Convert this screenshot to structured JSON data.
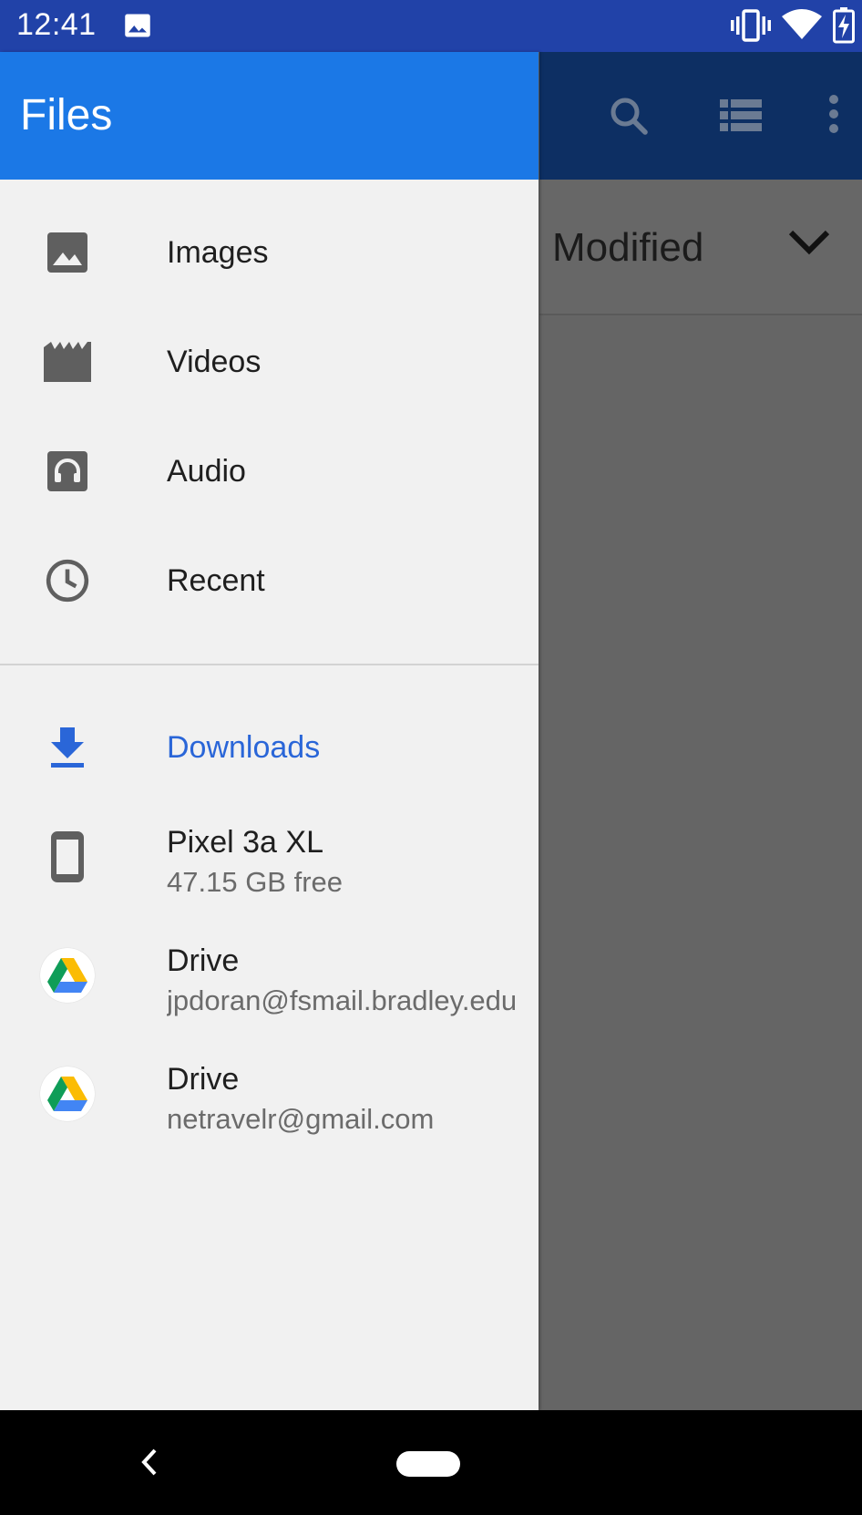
{
  "status_bar": {
    "time": "12:41",
    "icons": [
      "image-notification-icon",
      "vibrate-icon",
      "wifi-icon",
      "battery-charging-icon"
    ]
  },
  "drawer": {
    "title": "Files",
    "categories": [
      {
        "label": "Images",
        "icon": "image-icon"
      },
      {
        "label": "Videos",
        "icon": "movie-icon"
      },
      {
        "label": "Audio",
        "icon": "headphones-icon"
      },
      {
        "label": "Recent",
        "icon": "clock-icon"
      }
    ],
    "locations": [
      {
        "label": "Downloads",
        "icon": "download-icon",
        "active": true
      },
      {
        "label": "Pixel 3a XL",
        "sub": "47.15 GB free",
        "icon": "phone-icon"
      },
      {
        "label": "Drive",
        "sub": "jpdoran@fsmail.bradley.edu",
        "icon": "google-drive-icon"
      },
      {
        "label": "Drive",
        "sub": "netravelr@gmail.com",
        "icon": "google-drive-icon"
      }
    ],
    "accent_color": "#1b78e6",
    "active_color": "#2a66d8"
  },
  "background": {
    "sort_label": "Modified",
    "toolbar_icons": [
      "search-icon",
      "list-view-icon",
      "more-vert-icon"
    ]
  },
  "nav_bar": {
    "buttons": [
      "back-icon",
      "home-pill"
    ]
  }
}
